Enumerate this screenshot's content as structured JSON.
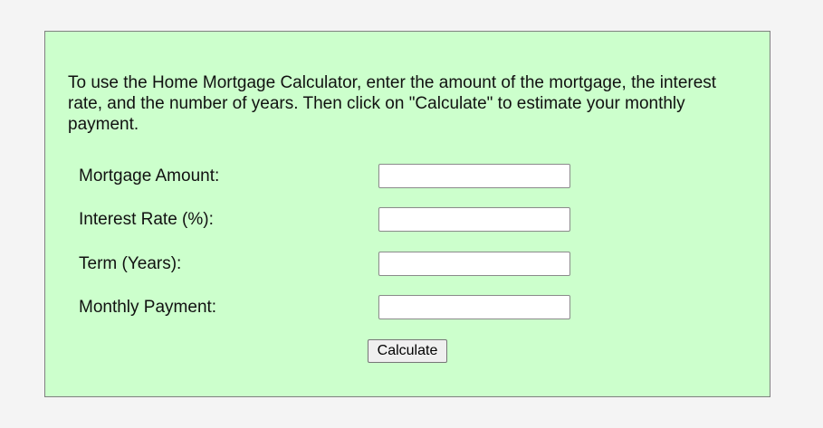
{
  "intro": {
    "text": "To use the Home Mortgage Calculator, enter the amount of the mortgage, the interest rate, and the number of years. Then click on \"Calculate\" to estimate your monthly payment."
  },
  "form": {
    "mortgage_amount": {
      "label": "Mortgage Amount:",
      "value": "",
      "placeholder": ""
    },
    "interest_rate": {
      "label": "Interest Rate (%):",
      "value": "",
      "placeholder": ""
    },
    "term_years": {
      "label": "Term (Years):",
      "value": "",
      "placeholder": ""
    },
    "monthly_payment": {
      "label": "Monthly Payment:",
      "value": "",
      "placeholder": ""
    },
    "calculate_label": "Calculate"
  },
  "colors": {
    "page_background": "#f4f4f4",
    "panel_background": "#ccffcc",
    "panel_border": "#808080"
  }
}
